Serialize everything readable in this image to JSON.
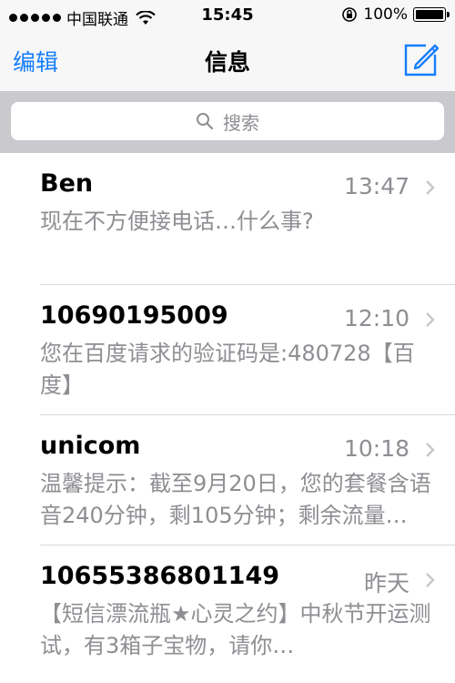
{
  "status_bar": {
    "carrier": "中国联通",
    "time": "15:45",
    "battery": "100%"
  },
  "nav": {
    "edit_label": "编辑",
    "title": "信息"
  },
  "search": {
    "placeholder": "搜索"
  },
  "messages": [
    {
      "name": "Ben",
      "time": "13:47",
      "preview": "现在不方便接电话…什么事?"
    },
    {
      "name": "10690195009",
      "time": "12:10",
      "preview": "您在百度请求的验证码是:480728【百度】"
    },
    {
      "name": "unicom",
      "time": "10:18",
      "preview": "温馨提示：截至9月20日，您的套餐含语音240分钟，剩105分钟；剩余流量…"
    },
    {
      "name": "10655386801149",
      "time": "昨天",
      "preview": "【短信漂流瓶★心灵之约】中秋节开运测试，有3箱子宝物，请你…"
    }
  ],
  "colors": {
    "accent": "#157efb",
    "secondary_text": "#8e8e93"
  }
}
